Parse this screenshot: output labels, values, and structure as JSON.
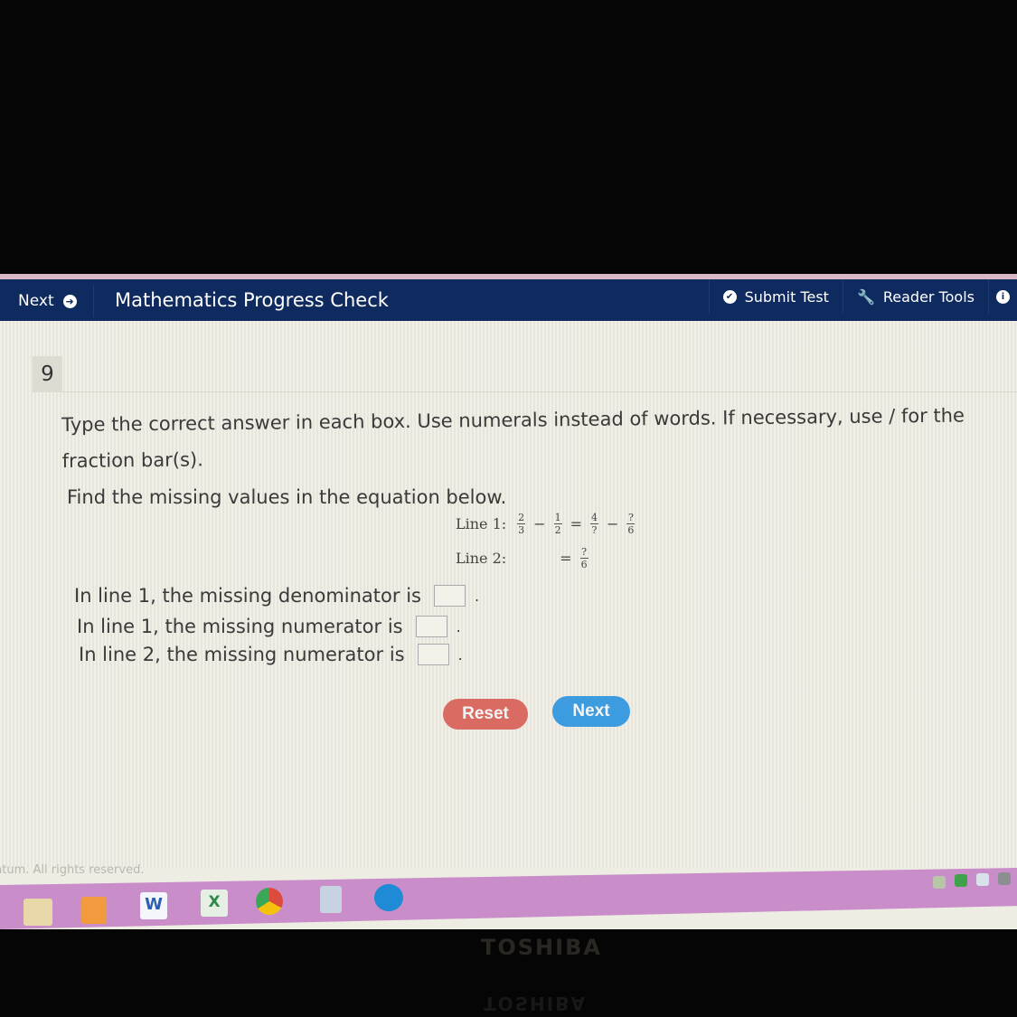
{
  "topbar": {
    "next_label": "Next",
    "title": "Mathematics Progress Check",
    "submit_label": "Submit Test",
    "reader_tools_label": "Reader Tools",
    "info_icon": "i"
  },
  "question": {
    "number": "9",
    "instructions": "Type the correct answer in each box.  Use numerals instead of words.  If necessary, use / for the fraction bar(s).",
    "prompt": "Find the missing values in the equation below.",
    "equation": {
      "line1_label": "Line 1:",
      "line2_label": "Line 2:",
      "line1_terms": [
        {
          "num": "2",
          "den": "3"
        },
        {
          "op": "−"
        },
        {
          "num": "1",
          "den": "2"
        },
        {
          "op": "="
        },
        {
          "num": "4",
          "den": "?"
        },
        {
          "op": "−"
        },
        {
          "num": "?",
          "den": "6"
        }
      ],
      "line2_terms": [
        {
          "op": "="
        },
        {
          "num": "?",
          "den": "6"
        }
      ]
    },
    "answers": [
      {
        "label": "In line 1, the missing denominator is",
        "value": "",
        "suffix": "."
      },
      {
        "label": "In line 1, the missing numerator is",
        "value": "",
        "suffix": "."
      },
      {
        "label": "In line 2, the missing numerator is",
        "value": "",
        "suffix": "."
      }
    ],
    "reset_label": "Reset",
    "next_label": "Next"
  },
  "footer": {
    "copyright": "ntum. All rights reserved."
  },
  "taskbar": {
    "apps": [
      "file-explorer",
      "media-player",
      "word",
      "excel",
      "chrome",
      "calculator",
      "edge"
    ],
    "tray": [
      "network",
      "security",
      "app",
      "notifications"
    ]
  },
  "monitor": {
    "brand": "TOSHIBA"
  },
  "colors": {
    "topbar": "#0f2a5e",
    "reset": "#d96b62",
    "next": "#3d9be0",
    "taskbar": "#c98ec9"
  }
}
